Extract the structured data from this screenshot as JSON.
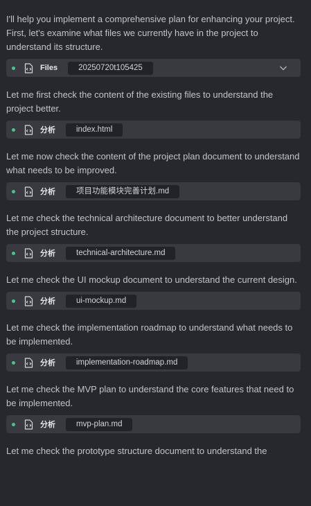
{
  "messages": [
    {
      "text": "I'll help you implement a comprehensive plan for enhancing your project. First, let's examine what files we currently have in the project to understand its structure.",
      "tool": {
        "label": "Files",
        "value": "20250720t105425",
        "icon": "file-code-icon",
        "expandable": true
      }
    },
    {
      "text": "Let me first check the content of the existing files to understand the project better.",
      "tool": {
        "label": "分析",
        "value": "index.html",
        "icon": "file-code-icon"
      }
    },
    {
      "text": "Let me now check the content of the project plan document to understand what needs to be improved.",
      "tool": {
        "label": "分析",
        "value": "项目功能模块完善计划.md",
        "icon": "file-code-icon"
      }
    },
    {
      "text": "Let me check the technical architecture document to better understand the project structure.",
      "tool": {
        "label": "分析",
        "value": "technical-architecture.md",
        "icon": "file-code-icon"
      }
    },
    {
      "text": "Let me check the UI mockup document to understand the current design.",
      "tool": {
        "label": "分析",
        "value": "ui-mockup.md",
        "icon": "file-code-icon"
      }
    },
    {
      "text": "Let me check the implementation roadmap to understand what needs to be implemented.",
      "tool": {
        "label": "分析",
        "value": "implementation-roadmap.md",
        "icon": "file-code-icon"
      }
    },
    {
      "text": "Let me check the MVP plan to understand the core features that need to be implemented.",
      "tool": {
        "label": "分析",
        "value": "mvp-plan.md",
        "icon": "file-code-icon"
      }
    }
  ],
  "trailing_text": "Let me check the prototype structure document to understand the",
  "colors": {
    "background": "#27282c",
    "tool_bar": "#393a3f",
    "chip": "#222327",
    "status_dot": "#43c98a",
    "text": "#c3c4c8"
  }
}
